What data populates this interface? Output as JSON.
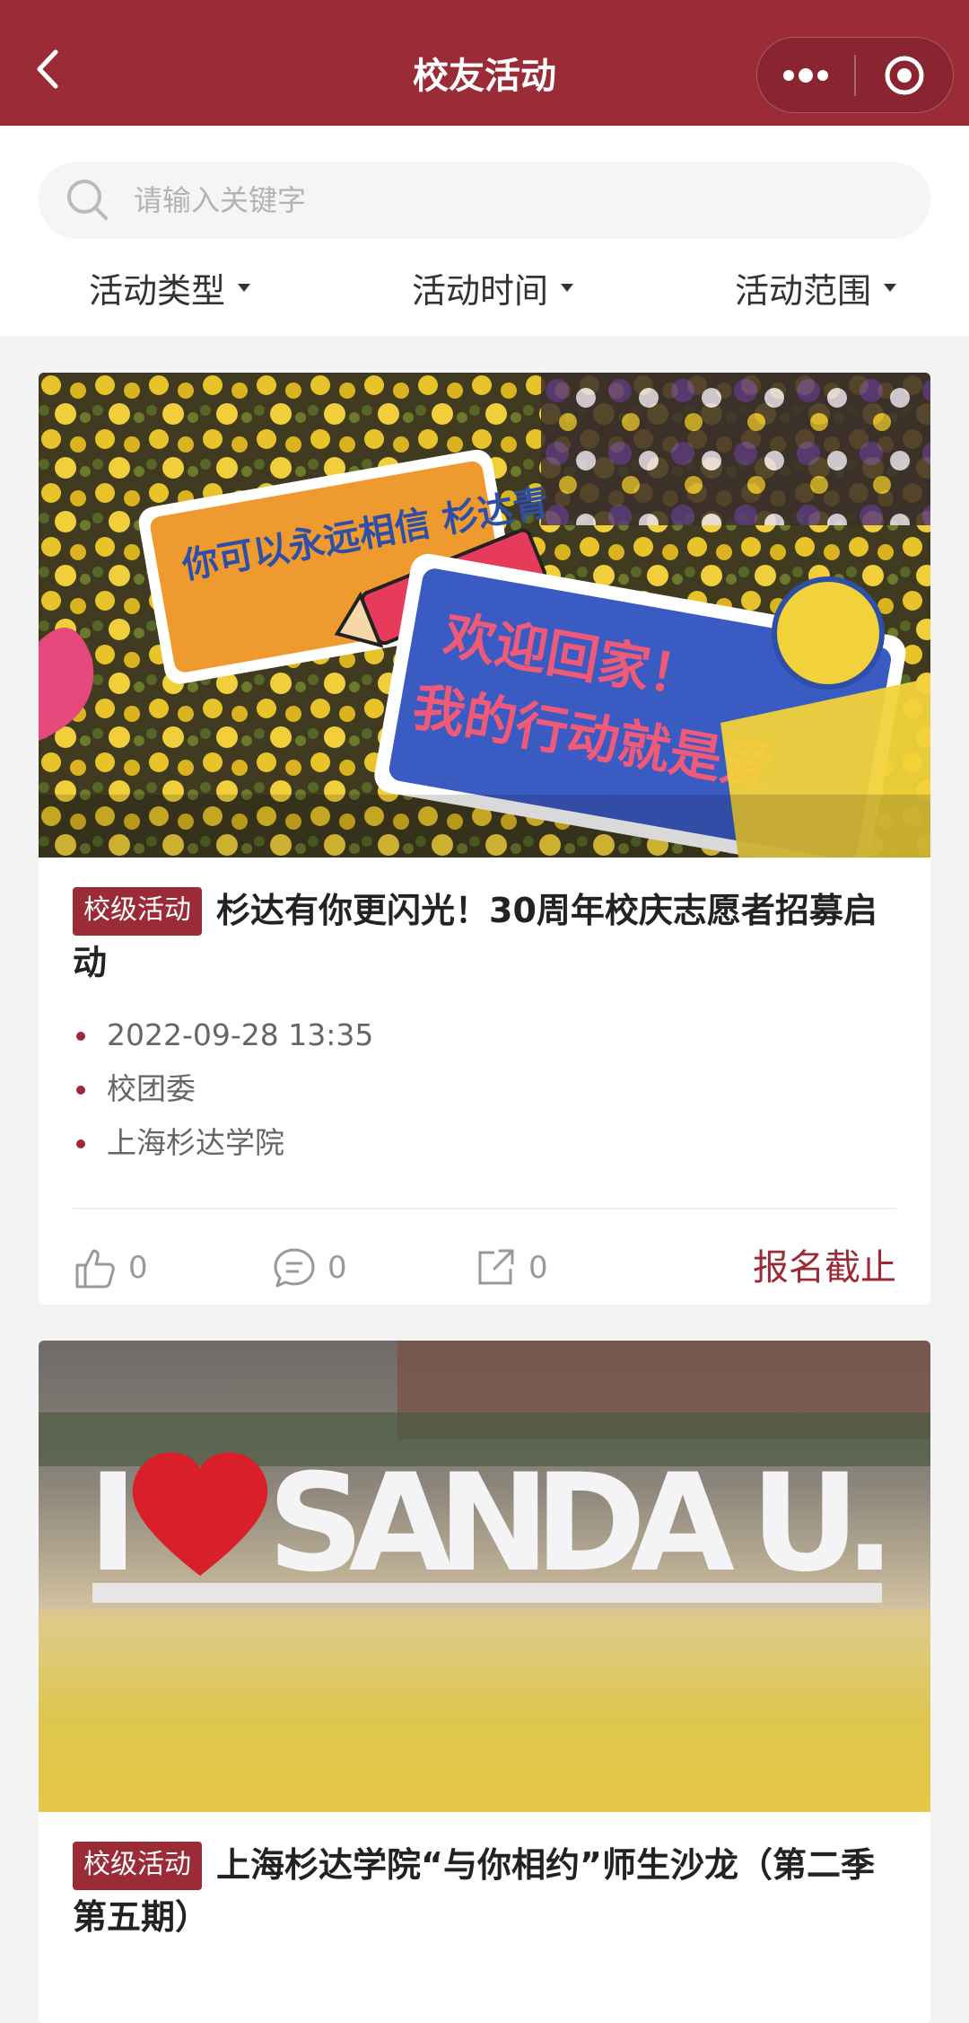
{
  "header": {
    "title": "校友活动",
    "accent_color": "#9b2b37",
    "back_icon": "chevron-left-icon",
    "more_icon": "more-dots-icon",
    "record_icon": "record-target-icon"
  },
  "search": {
    "placeholder": "请输入关键字",
    "value": "",
    "icon": "search-icon"
  },
  "filters": [
    {
      "label": "活动类型"
    },
    {
      "label": "活动时间"
    },
    {
      "label": "活动范围"
    }
  ],
  "cards": [
    {
      "tag": "校级活动",
      "title": "杉达有你更闪光！30周年校庆志愿者招募启动",
      "datetime": "2022-09-28 13:35",
      "organizer": "校团委",
      "location": "上海杉达学院",
      "likes": "0",
      "comments": "0",
      "shares": "0",
      "status": "报名截止",
      "image": {
        "sign1_text": "你可以永远相信 杉达青",
        "sign2_line1": "欢迎回家！",
        "sign2_line2": "我的行动就是爱"
      }
    },
    {
      "tag": "校级活动",
      "title": "上海杉达学院“与你相约”师生沙龙（第二季第五期）",
      "image": {
        "sign_letter_i": "I",
        "sign_text": "SANDA U."
      }
    }
  ]
}
